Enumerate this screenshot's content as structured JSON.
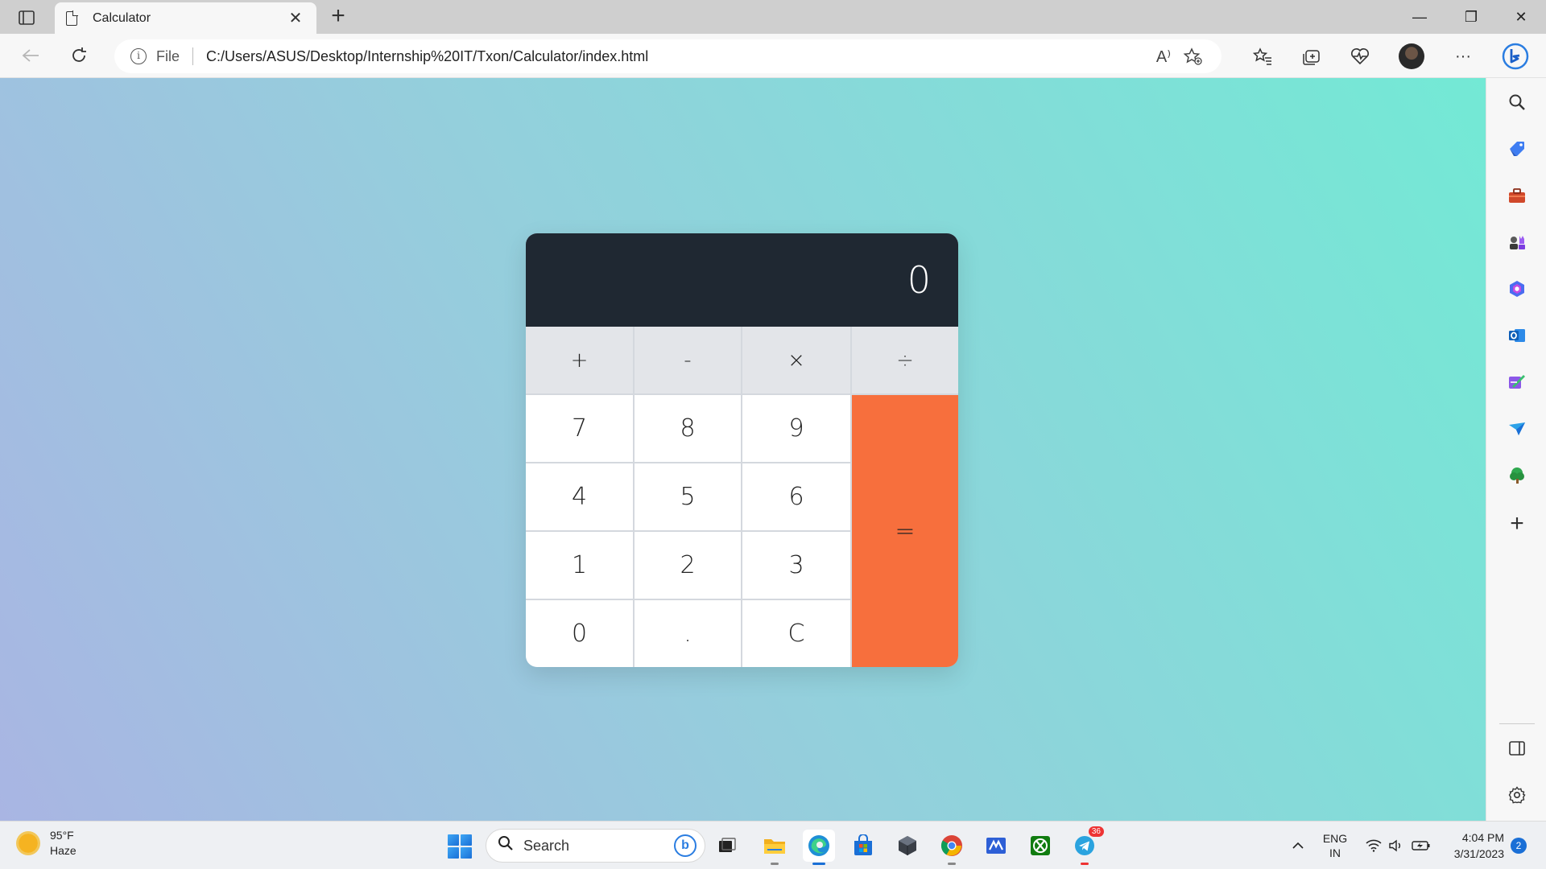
{
  "browser": {
    "tab_title": "Calculator",
    "tab_close": "✕",
    "new_tab": "+",
    "address_scheme": "File",
    "address_url": "C:/Users/ASUS/Desktop/Internship%20IT/Txon/Calculator/index.html",
    "read_aloud": "A⁾",
    "window_controls": {
      "minimize": "—",
      "restore": "❐",
      "close": "✕"
    },
    "more_menu": "···"
  },
  "calculator": {
    "display_value": "0",
    "operators": [
      "+",
      "-",
      "×",
      "÷"
    ],
    "digits_row1": [
      "7",
      "8",
      "9"
    ],
    "digits_row2": [
      "4",
      "5",
      "6"
    ],
    "digits_row3": [
      "1",
      "2",
      "3"
    ],
    "bottom_row": [
      "0",
      ".",
      "C"
    ],
    "equals": "=",
    "colors": {
      "display_bg": "#1f2832",
      "equals_bg": "#f76f3d",
      "operator_bg": "#e3e5e9"
    }
  },
  "sidebar": {
    "icons": [
      "search-icon",
      "tag-icon",
      "toolbox-icon",
      "chess-icon",
      "office-icon",
      "outlook-icon",
      "designer-icon",
      "send-icon",
      "tree-icon",
      "add-icon"
    ],
    "add_label": "+",
    "bottom_icons": [
      "sidebar-toggle-icon",
      "settings-icon"
    ]
  },
  "taskbar": {
    "weather_temp": "95°F",
    "weather_desc": "Haze",
    "search_placeholder": "Search",
    "apps": [
      "task-view",
      "file-explorer",
      "edge",
      "microsoft-store",
      "unity",
      "chrome",
      "visual-studio",
      "xbox",
      "telegram"
    ],
    "telegram_badge": "36",
    "lang_line1": "ENG",
    "lang_line2": "IN",
    "time": "4:04 PM",
    "date": "3/31/2023",
    "notification_count": "2"
  }
}
